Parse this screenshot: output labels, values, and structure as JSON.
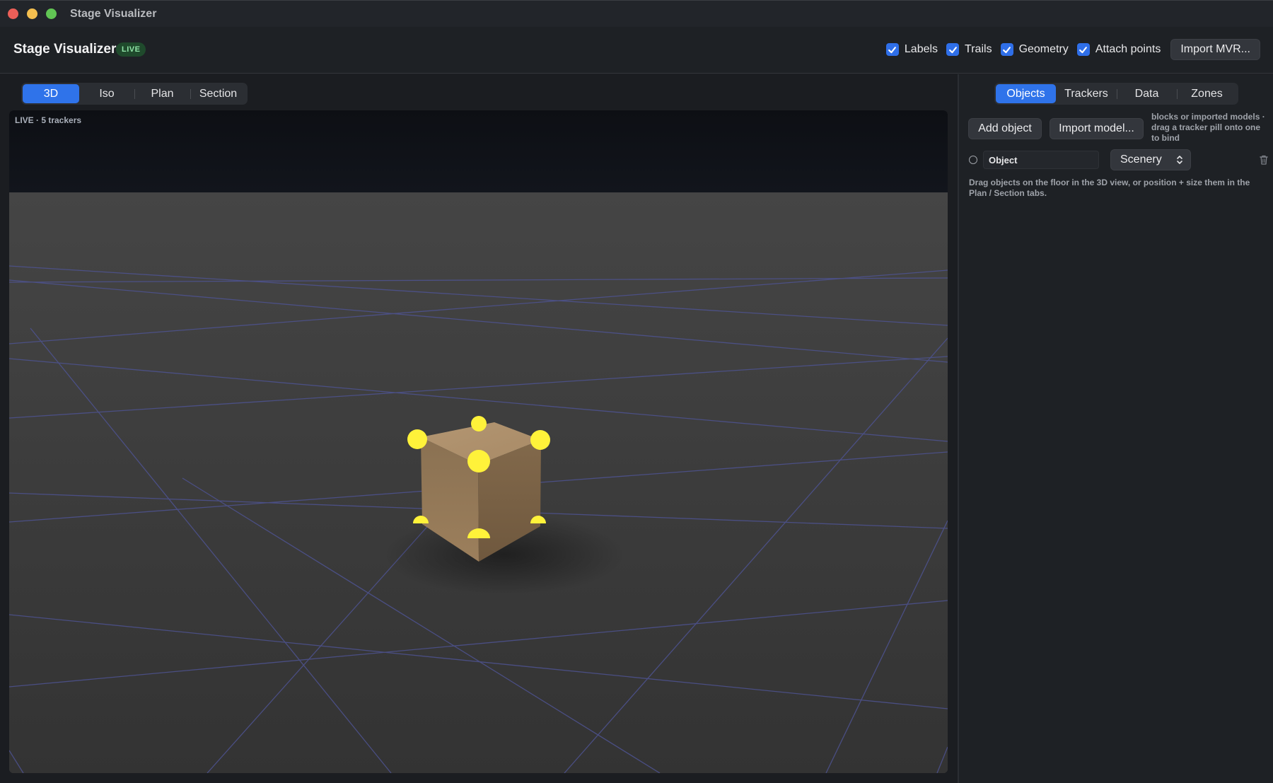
{
  "window": {
    "title": "Stage Visualizer"
  },
  "header": {
    "title": "Stage Visualizer",
    "badge": "LIVE",
    "toggles": [
      {
        "label": "Labels",
        "checked": true
      },
      {
        "label": "Trails",
        "checked": true
      },
      {
        "label": "Geometry",
        "checked": true
      },
      {
        "label": "Attach points",
        "checked": true
      }
    ],
    "import_mvr_label": "Import MVR..."
  },
  "view_tabs": {
    "items": [
      "3D",
      "Iso",
      "Plan",
      "Section"
    ],
    "active": "3D"
  },
  "viewport": {
    "status": "LIVE · 5 trackers"
  },
  "panel": {
    "tabs": {
      "items": [
        "Objects",
        "Trackers",
        "Data",
        "Zones"
      ],
      "active": "Objects"
    },
    "add_object_label": "Add object",
    "import_model_label": "Import model...",
    "hint": "blocks or imported models · drag a tracker pill onto one to bind",
    "object_row": {
      "name": "Object",
      "type": "Scenery"
    },
    "help_text": "Drag objects on the floor in the 3D view, or position + size them in the Plan / Section tabs."
  },
  "colors": {
    "accent": "#2f73ea",
    "attach_point": "#fff23a",
    "object": "#9b8060",
    "grid": "#4a4f8a"
  }
}
